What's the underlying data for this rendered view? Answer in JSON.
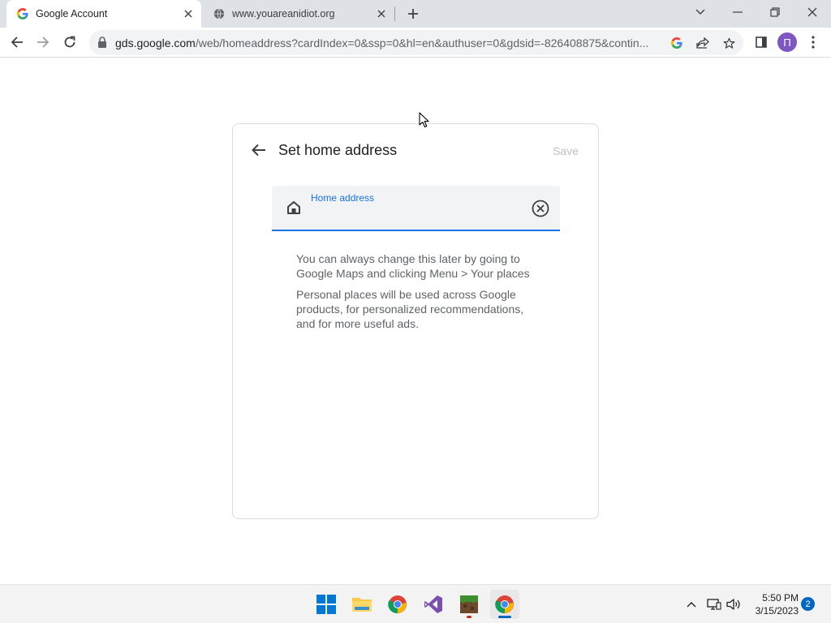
{
  "browser": {
    "tabs": [
      {
        "title": "Google Account",
        "active": true,
        "icon": "google-g-icon"
      },
      {
        "title": "www.youareanidiot.org",
        "active": false,
        "icon": "globe-icon"
      }
    ],
    "url_host": "gds.google.com",
    "url_path": "/web/homeaddress?cardIndex=0&ssp=0&hl=en&authuser=0&gdsid=-826408875&contin...",
    "profile_initial": "П",
    "profile_color": "#7e57c2"
  },
  "page": {
    "title": "Set home address",
    "save_label": "Save",
    "field_label": "Home address",
    "field_value": "",
    "note_1": "You can always change this later by going to Google Maps and clicking Menu > Your places",
    "note_2": "Personal places will be used across Google products, for personalized recommendations, and for more useful ads.",
    "accent_color": "#1a73e8"
  },
  "taskbar": {
    "apps": [
      "windows-start-icon",
      "file-explorer-icon",
      "chrome-icon",
      "visual-studio-icon",
      "minecraft-icon",
      "chrome-icon"
    ],
    "time": "5:50 PM",
    "date": "3/15/2023",
    "notifications": "2"
  }
}
